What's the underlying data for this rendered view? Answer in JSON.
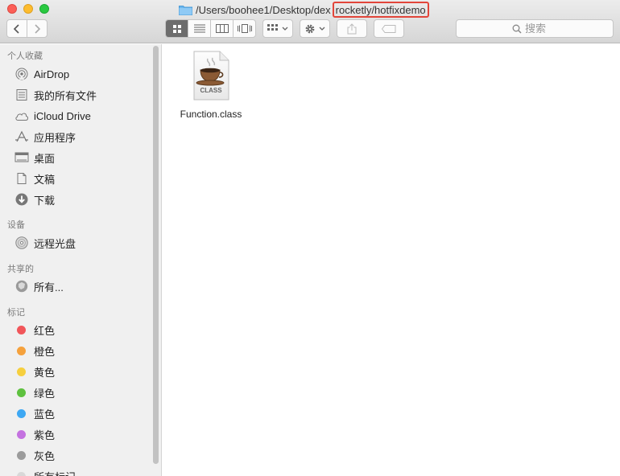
{
  "window": {
    "path_prefix": "/Users/boohee1/Desktop/dex",
    "path_highlighted": "rocketly/hotfixdemo"
  },
  "toolbar": {
    "search_placeholder": "搜索"
  },
  "sidebar": {
    "favorites_heading": "个人收藏",
    "favorites": [
      {
        "label": "AirDrop",
        "icon": "airdrop-icon"
      },
      {
        "label": "我的所有文件",
        "icon": "all-files-icon"
      },
      {
        "label": "iCloud Drive",
        "icon": "cloud-icon"
      },
      {
        "label": "应用程序",
        "icon": "applications-icon"
      },
      {
        "label": "桌面",
        "icon": "desktop-icon"
      },
      {
        "label": "文稿",
        "icon": "documents-icon"
      },
      {
        "label": "下载",
        "icon": "download-icon"
      }
    ],
    "devices_heading": "设备",
    "devices": [
      {
        "label": "远程光盘",
        "icon": "remote-disc-icon"
      }
    ],
    "shared_heading": "共享的",
    "shared": [
      {
        "label": "所有...",
        "icon": "network-icon"
      }
    ],
    "tags_heading": "标记",
    "tags": [
      {
        "label": "红色",
        "color": "#f1565a"
      },
      {
        "label": "橙色",
        "color": "#f5a13c"
      },
      {
        "label": "黄色",
        "color": "#f6cf3e"
      },
      {
        "label": "绿色",
        "color": "#5ec13f"
      },
      {
        "label": "蓝色",
        "color": "#3ea8f3"
      },
      {
        "label": "紫色",
        "color": "#c472e0"
      },
      {
        "label": "灰色",
        "color": "#9b9b9b"
      },
      {
        "label": "所有标记",
        "color": "#d8d8d8"
      }
    ]
  },
  "files": [
    {
      "name": "Function.class",
      "badge": "CLASS",
      "icon": "java-class-file-icon"
    }
  ]
}
